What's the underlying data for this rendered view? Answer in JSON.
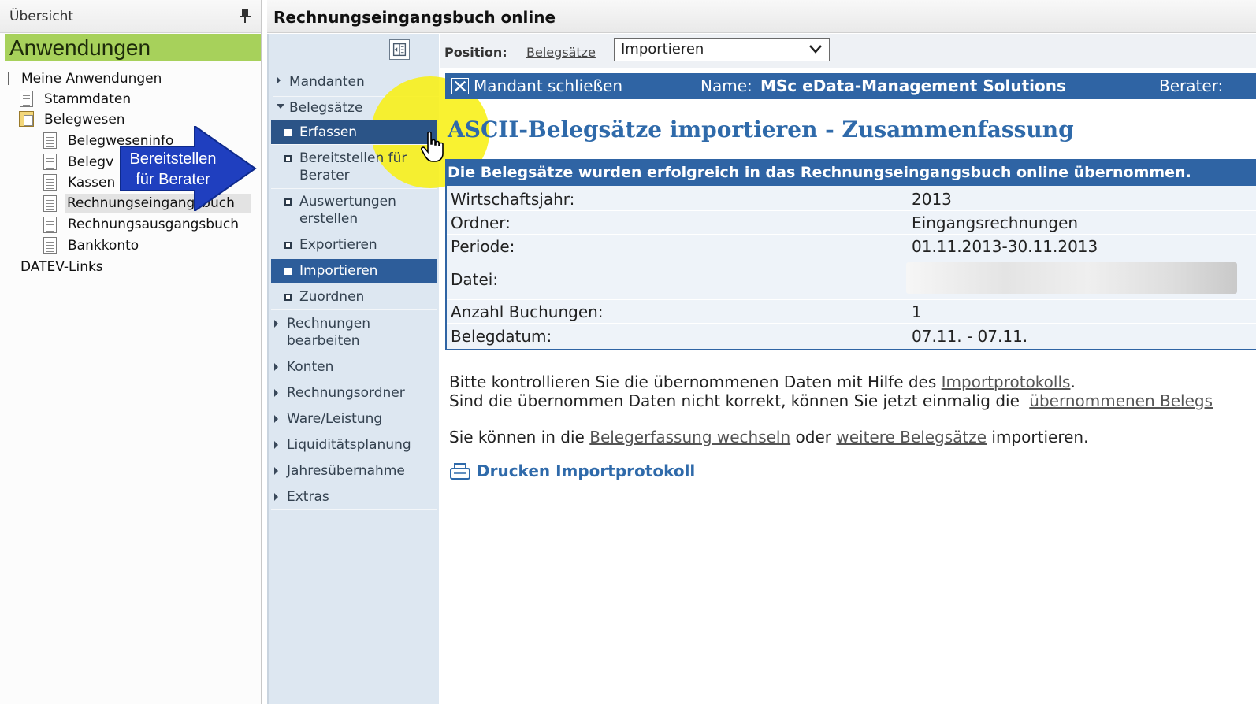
{
  "left_panel": {
    "header_title": "Übersicht",
    "apps_title": "Anwendungen",
    "tree": {
      "my_apps": "Meine Anwendungen",
      "stammdaten": "Stammdaten",
      "belegwesen": "Belegwesen",
      "children": [
        "Belegweseninfo",
        "Belegv",
        "Kassen",
        "Rechnungseingangsbuch",
        "Rechnungsausgangsbuch",
        "Bankkonto"
      ],
      "datev_links": "DATEV-Links"
    },
    "callout": {
      "line1": "Bereitstellen",
      "line2": "für Berater",
      "color": "#1f3fbf"
    }
  },
  "main_header": {
    "title": "Rechnungseingangsbuch online"
  },
  "nav": {
    "collapse_icon": "collapse-panel-icon",
    "items": {
      "mandanten": "Mandanten",
      "belegsaetze": "Belegsätze",
      "erfassen": "Erfassen",
      "bereitstellen_1": "Bereitstellen für",
      "bereitstellen_2": "Berater",
      "auswertungen_1": "Auswertungen",
      "auswertungen_2": "erstellen",
      "exportieren": "Exportieren",
      "importieren": "Importieren",
      "zuordnen": "Zuordnen",
      "rechnungen_1": "Rechnungen",
      "rechnungen_2": "bearbeiten",
      "konten": "Konten",
      "rechnungsordner": "Rechnungsordner",
      "ware": "Ware/Leistung",
      "liquiditaet": "Liquiditätsplanung",
      "jahresuebernahme": "Jahresübernahme",
      "extras": "Extras"
    }
  },
  "position_bar": {
    "label": "Position:",
    "link": "Belegsätze",
    "select_value": "Importieren"
  },
  "mandant_bar": {
    "close_label": "Mandant schließen",
    "name_label": "Name:",
    "name_value": "MSc eData-Management Solutions",
    "berater_label": "Berater:"
  },
  "content": {
    "title": "ASCII-Belegsätze importieren - Zusammenfassung",
    "banner": "Die Belegsätze wurden erfolgreich in das Rechnungseingangsbuch online übernommen.",
    "summary": {
      "wirtschaftsjahr_label": "Wirtschaftsjahr:",
      "wirtschaftsjahr_value": "2013",
      "ordner_label": "Ordner:",
      "ordner_value": "Eingangsrechnungen",
      "periode_label": "Periode:",
      "periode_value": "01.11.2013-30.11.2013",
      "datei_label": "Datei:",
      "anzahl_label": "Anzahl Buchungen:",
      "anzahl_value": "1",
      "belegdatum_label": "Belegdatum:",
      "belegdatum_value": "07.11. - 07.11."
    },
    "para1_text": "Bitte kontrollieren Sie die übernommenen Daten mit Hilfe des ",
    "para1_link": "Importprotokolls",
    "para1_end": ".",
    "para2_text": "Sind die übernommen Daten nicht korrekt, können Sie jetzt einmalig die ",
    "para2_link": "übernommenen Belegs",
    "para3_start": "Sie können in die ",
    "para3_link1": "Belegerfassung wechseln",
    "para3_mid": " oder ",
    "para3_link2": "weitere Belegsätze",
    "para3_end": " importieren.",
    "print_label": "Drucken Importprotokoll"
  },
  "colors": {
    "accent_blue": "#2f64a4",
    "apps_green": "#a7d15b",
    "highlight_yellow": "#f8f014",
    "nav_active": "#2d5d9a"
  }
}
